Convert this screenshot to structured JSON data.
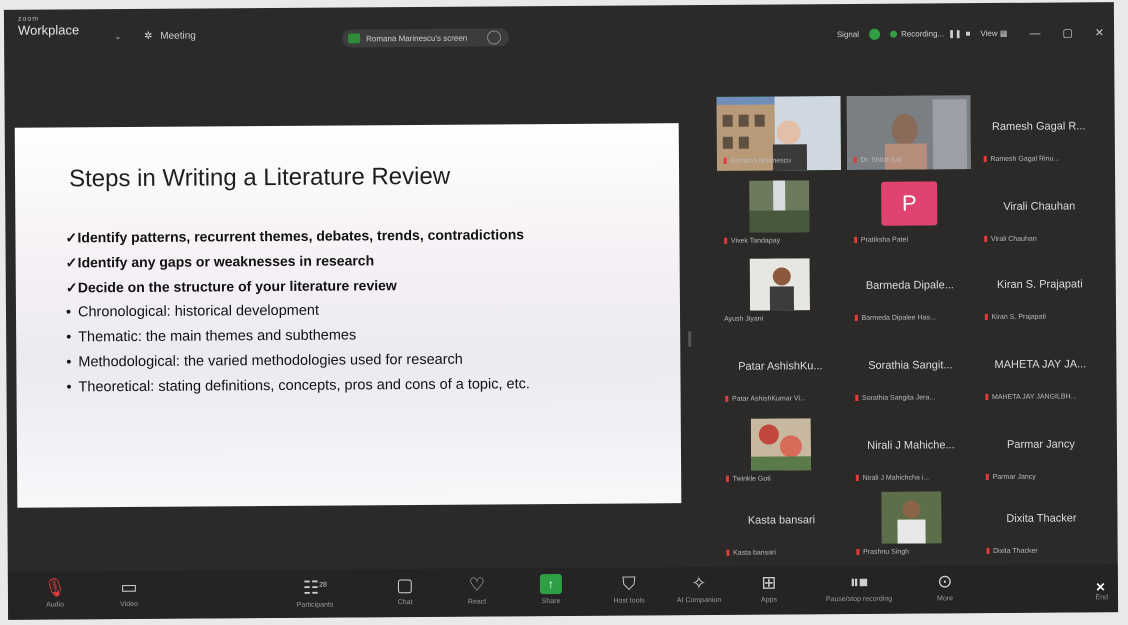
{
  "topbar": {
    "brand_small": "zoom",
    "brand": "Workplace",
    "meeting_label": "Meeting",
    "sharing_text": "Romana Marinescu's screen",
    "signal_text": "Signal",
    "recording_text": "Recording...",
    "view_text": "View",
    "minimize": "—",
    "restore": "▢",
    "close": "✕"
  },
  "slide": {
    "title": "Steps in Writing a Literature Review",
    "bullets": [
      {
        "mark": "✓",
        "text": "Identify patterns, recurrent themes, debates, trends, contradictions"
      },
      {
        "mark": "✓",
        "text": "Identify any gaps or weaknesses in research"
      },
      {
        "mark": "✓",
        "text": "Decide on the structure of your literature review"
      },
      {
        "mark": "•",
        "text": "Chronological: historical development"
      },
      {
        "mark": "•",
        "text": "Thematic: the main themes and subthemes"
      },
      {
        "mark": "•",
        "text": "Methodological: the varied methodologies used for research"
      },
      {
        "mark": "•",
        "text": "Theoretical: stating definitions, concepts, pros and cons of a topic, etc."
      }
    ]
  },
  "participants": [
    {
      "name": "",
      "label": "Romana Marinescu"
    },
    {
      "name": "",
      "label": "Dr. Shital Sali"
    },
    {
      "name": "Ramesh Gagal R...",
      "label": "Ramesh Gagal Rinu..."
    },
    {
      "name": "",
      "label": "Vivek Tandapay"
    },
    {
      "name": "",
      "label": "Pratiksha Patel",
      "initial": "P"
    },
    {
      "name": "Virali Chauhan",
      "label": "Virali Chauhan"
    },
    {
      "name": "",
      "label": "Ayush Jiyani"
    },
    {
      "name": "Barmeda Dipale...",
      "label": "Barmeda Dipalee Has..."
    },
    {
      "name": "Kiran S. Prajapati",
      "label": "Kiran S. Prajapati"
    },
    {
      "name": "Patar AshishKu...",
      "label": "Patar AshishKumar Vi..."
    },
    {
      "name": "Sorathia Sangit...",
      "label": "Sorathia Sangita Jera..."
    },
    {
      "name": "MAHETA JAY JA...",
      "label": "MAHETA JAY JANGILBH..."
    },
    {
      "name": "",
      "label": "Twinkle Goti"
    },
    {
      "name": "Nirali J Mahiche...",
      "label": "Nirali J Mahichcha i..."
    },
    {
      "name": "Parmar Jancy",
      "label": "Parmar Jancy"
    },
    {
      "name": "Kasta bansari",
      "label": "Kasta bansari"
    },
    {
      "name": "",
      "label": "Prashnu Singh"
    },
    {
      "name": "Dixita Thacker",
      "label": "Dixita Thacker"
    }
  ],
  "toolbar": {
    "audio": "Audio",
    "video": "Video",
    "participants": "Participants",
    "participants_count": "28",
    "chat": "Chat",
    "react": "React",
    "share": "Share",
    "host_tools": "Host tools",
    "ai_companion": "AI Companion",
    "apps": "Apps",
    "recording": "Pause/stop recording",
    "more": "More",
    "end": "End"
  },
  "colors": {
    "accent_green": "#2f9e44",
    "avatar_pink": "#e0446e",
    "muted_red": "#e03c3c"
  }
}
